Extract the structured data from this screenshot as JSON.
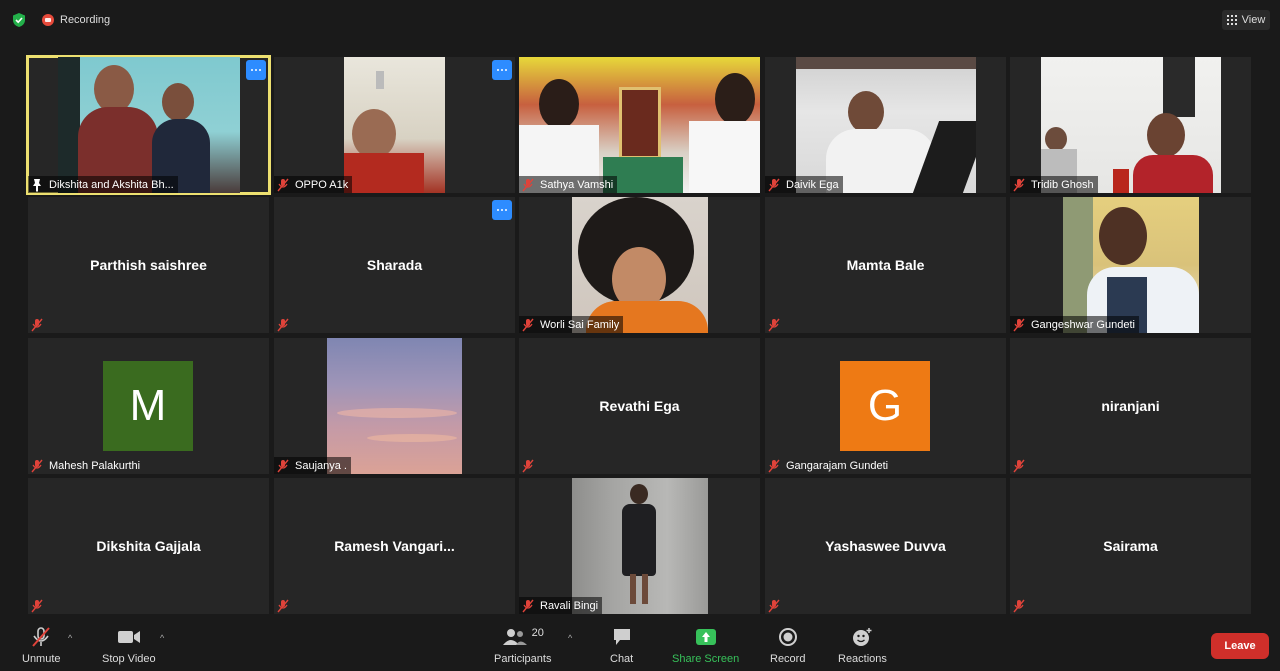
{
  "topbar": {
    "recording_label": "Recording",
    "view_label": "View"
  },
  "tiles": {
    "t0": {
      "name": "Dikshita and Akshita  Bh..."
    },
    "t1": {
      "name": "OPPO A1k"
    },
    "t2": {
      "name": "Sathya Vamshi"
    },
    "t3": {
      "name": "Daivik Ega"
    },
    "t4": {
      "name": "Tridib Ghosh"
    },
    "t5": {
      "name": "Parthish saishree"
    },
    "t6": {
      "name": "Sharada"
    },
    "t7": {
      "name": "Worli Sai Family"
    },
    "t8": {
      "name": "Mamta Bale"
    },
    "t9": {
      "name": "Gangeshwar Gundeti"
    },
    "t10": {
      "name": "Mahesh Palakurthi",
      "initial": "M",
      "color": "#3a6b1f"
    },
    "t11": {
      "name": "Saujanya ."
    },
    "t12": {
      "name": "Revathi Ega"
    },
    "t13": {
      "name": "Gangarajam Gundeti",
      "initial": "G",
      "color": "#ee7a14"
    },
    "t14": {
      "name": "niranjani"
    },
    "t15": {
      "name": "Dikshita Gajjala"
    },
    "t16": {
      "name": "Ramesh  Vangari..."
    },
    "t17": {
      "name": "Ravali Bingi"
    },
    "t18": {
      "name": "Yashaswee Duvva"
    },
    "t19": {
      "name": "Sairama"
    }
  },
  "toolbar": {
    "unmute_label": "Unmute",
    "stop_video_label": "Stop Video",
    "participants_label": "Participants",
    "participants_count": "20",
    "chat_label": "Chat",
    "share_screen_label": "Share Screen",
    "record_label": "Record",
    "reactions_label": "Reactions",
    "leave_label": "Leave"
  },
  "colors": {
    "accent_blue": "#2d8cff",
    "active_border": "#ede070",
    "share_green": "#37c15a",
    "leave_red": "#cf2f2a",
    "mute_red": "#e0433a"
  }
}
